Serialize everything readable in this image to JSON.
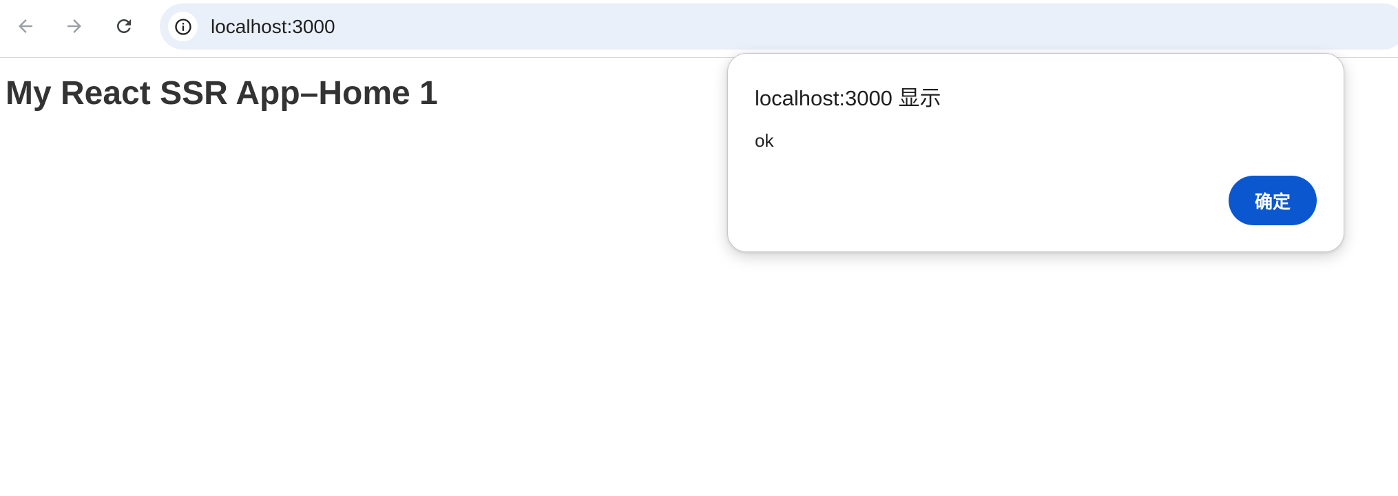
{
  "browser": {
    "address": "localhost:3000",
    "icons": {
      "back": "arrow-left-icon",
      "forward": "arrow-right-icon",
      "reload": "reload-icon",
      "site_info": "info-icon"
    },
    "colors": {
      "omnibox_background": "#eaf0f9",
      "nav_icon_disabled": "#9aa0a6",
      "nav_icon_active": "#3c4043"
    }
  },
  "page": {
    "heading": "My React SSR App–Home 1"
  },
  "dialog": {
    "title": "localhost:3000 显示",
    "message": "ok",
    "ok_label": "确定",
    "colors": {
      "button_background": "#0b57d0",
      "button_text": "#ffffff"
    }
  }
}
